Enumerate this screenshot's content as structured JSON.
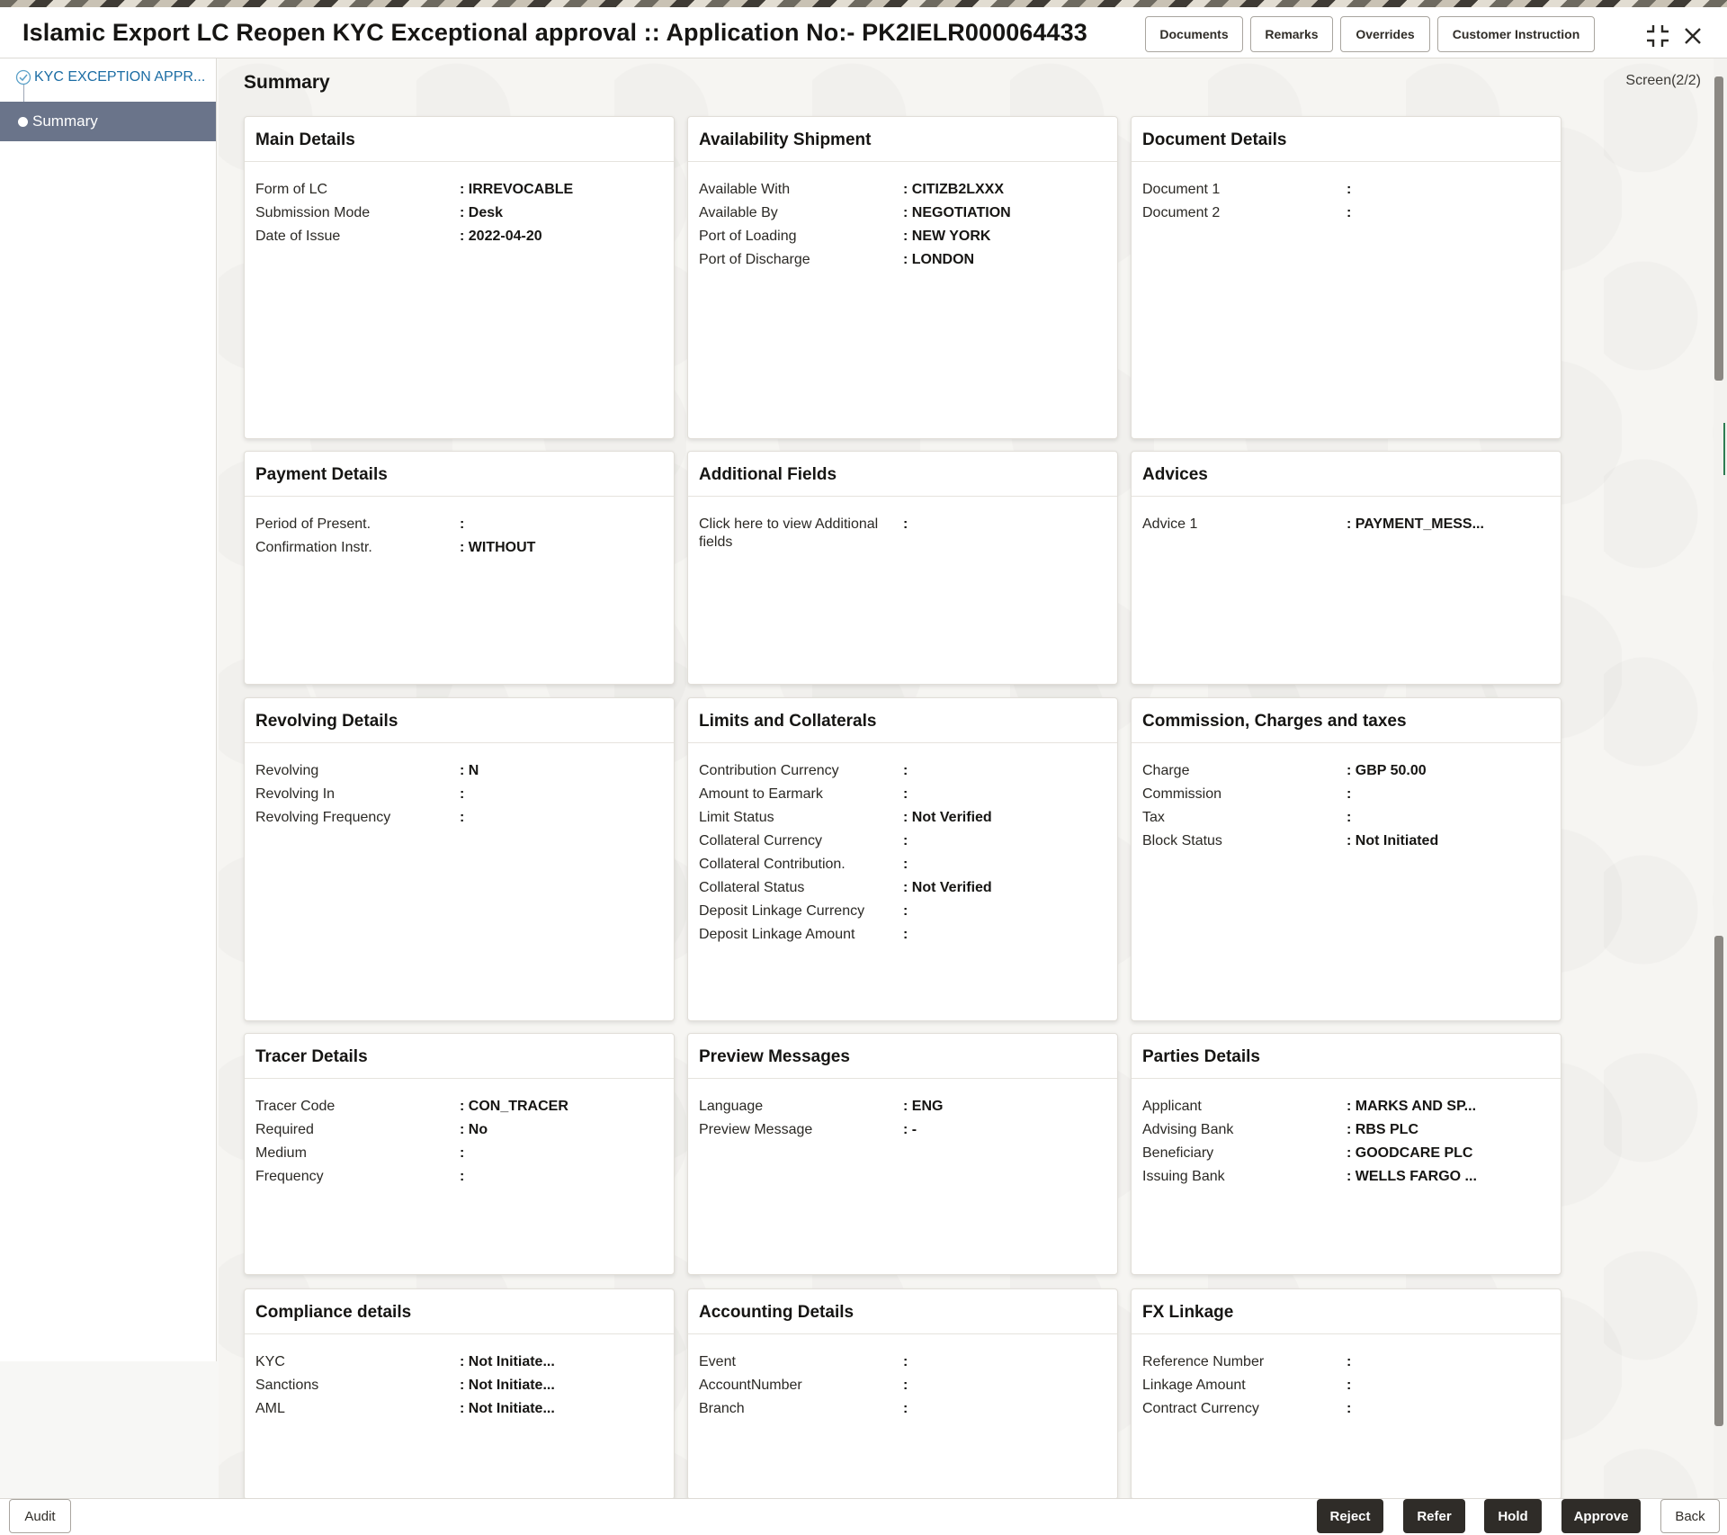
{
  "window": {
    "title": "Islamic Export LC Reopen KYC Exceptional approval :: Application No:- PK2IELR000064433"
  },
  "toolbar": {
    "documents_label": "Documents",
    "remarks_label": "Remarks",
    "overrides_label": "Overrides",
    "customer_instruction_label": "Customer Instruction"
  },
  "sidebar": {
    "items": [
      {
        "label": "KYC EXCEPTION APPR...",
        "state": "completed"
      },
      {
        "label": "Summary",
        "state": "active"
      }
    ]
  },
  "main": {
    "title": "Summary",
    "screen_indicator": "Screen(2/2)"
  },
  "cards": [
    {
      "title": "Main Details",
      "rows": [
        {
          "label": "Form of LC",
          "value": ": IRREVOCABLE"
        },
        {
          "label": "Submission Mode",
          "value": ": Desk"
        },
        {
          "label": "Date of Issue",
          "value": ": 2022-04-20"
        }
      ]
    },
    {
      "title": "Availability Shipment",
      "rows": [
        {
          "label": "Available With",
          "value": ": CITIZB2LXXX"
        },
        {
          "label": "Available By",
          "value": ": NEGOTIATION"
        },
        {
          "label": "Port of Loading",
          "value": ": NEW YORK"
        },
        {
          "label": "Port of Discharge",
          "value": ": LONDON"
        }
      ]
    },
    {
      "title": "Document Details",
      "rows": [
        {
          "label": "Document 1",
          "value": ":"
        },
        {
          "label": "Document 2",
          "value": ":"
        }
      ]
    },
    {
      "title": "Payment Details",
      "rows": [
        {
          "label": "Period of Present.",
          "value": ":"
        },
        {
          "label": "Confirmation Instr.",
          "value": ": WITHOUT"
        }
      ]
    },
    {
      "title": "Additional Fields",
      "rows": [
        {
          "label": "Click here to view Additional fields",
          "value": ":"
        }
      ]
    },
    {
      "title": "Advices",
      "rows": [
        {
          "label": "Advice 1",
          "value": ": PAYMENT_MESS..."
        }
      ]
    },
    {
      "title": "Revolving Details",
      "rows": [
        {
          "label": "Revolving",
          "value": ": N"
        },
        {
          "label": "Revolving In",
          "value": ":"
        },
        {
          "label": "Revolving Frequency",
          "value": ":"
        }
      ]
    },
    {
      "title": "Limits and Collaterals",
      "rows": [
        {
          "label": "Contribution Currency",
          "value": ":"
        },
        {
          "label": "Amount to Earmark",
          "value": ":"
        },
        {
          "label": "Limit Status",
          "value": ": Not Verified"
        },
        {
          "label": "Collateral Currency",
          "value": ":"
        },
        {
          "label": "Collateral Contribution.",
          "value": ":"
        },
        {
          "label": "Collateral Status",
          "value": ": Not Verified"
        },
        {
          "label": "Deposit Linkage Currency",
          "value": ":"
        },
        {
          "label": "Deposit Linkage Amount",
          "value": ":"
        }
      ]
    },
    {
      "title": "Commission, Charges and taxes",
      "rows": [
        {
          "label": "Charge",
          "value": ": GBP  50.00"
        },
        {
          "label": "Commission",
          "value": ":"
        },
        {
          "label": "Tax",
          "value": ":"
        },
        {
          "label": "Block Status",
          "value": ": Not Initiated"
        }
      ]
    },
    {
      "title": "Tracer Details",
      "rows": [
        {
          "label": "Tracer Code",
          "value": ": CON_TRACER"
        },
        {
          "label": "Required",
          "value": ": No"
        },
        {
          "label": "Medium",
          "value": ":"
        },
        {
          "label": "Frequency",
          "value": ":"
        }
      ]
    },
    {
      "title": "Preview Messages",
      "rows": [
        {
          "label": "Language",
          "value": ": ENG"
        },
        {
          "label": "Preview Message",
          "value": ": -"
        }
      ]
    },
    {
      "title": "Parties Details",
      "rows": [
        {
          "label": "Applicant",
          "value": ": MARKS AND SP..."
        },
        {
          "label": "Advising Bank",
          "value": ": RBS PLC"
        },
        {
          "label": "Beneficiary",
          "value": ": GOODCARE PLC"
        },
        {
          "label": "Issuing Bank",
          "value": ": WELLS FARGO ..."
        }
      ]
    },
    {
      "title": "Compliance details",
      "rows": [
        {
          "label": "KYC",
          "value": ": Not Initiate..."
        },
        {
          "label": "Sanctions",
          "value": ": Not Initiate..."
        },
        {
          "label": "AML",
          "value": ": Not Initiate..."
        }
      ]
    },
    {
      "title": "Accounting Details",
      "rows": [
        {
          "label": "Event",
          "value": ":"
        },
        {
          "label": "AccountNumber",
          "value": ":"
        },
        {
          "label": "Branch",
          "value": ":"
        }
      ]
    },
    {
      "title": "FX Linkage",
      "rows": [
        {
          "label": "Reference Number",
          "value": ":"
        },
        {
          "label": "Linkage Amount",
          "value": ":"
        },
        {
          "label": "Contract Currency",
          "value": ":"
        }
      ]
    }
  ],
  "footer": {
    "audit_label": "Audit",
    "reject_label": "Reject",
    "refer_label": "Refer",
    "hold_label": "Hold",
    "approve_label": "Approve",
    "back_label": "Back"
  },
  "icons": {
    "collapse": "collapse-icon",
    "close": "close-icon",
    "step_done": "check-circle-icon"
  },
  "colors": {
    "active_step_bg": "#6a748a",
    "step_link": "#1c6da4",
    "primary_button": "#2f2c28"
  }
}
